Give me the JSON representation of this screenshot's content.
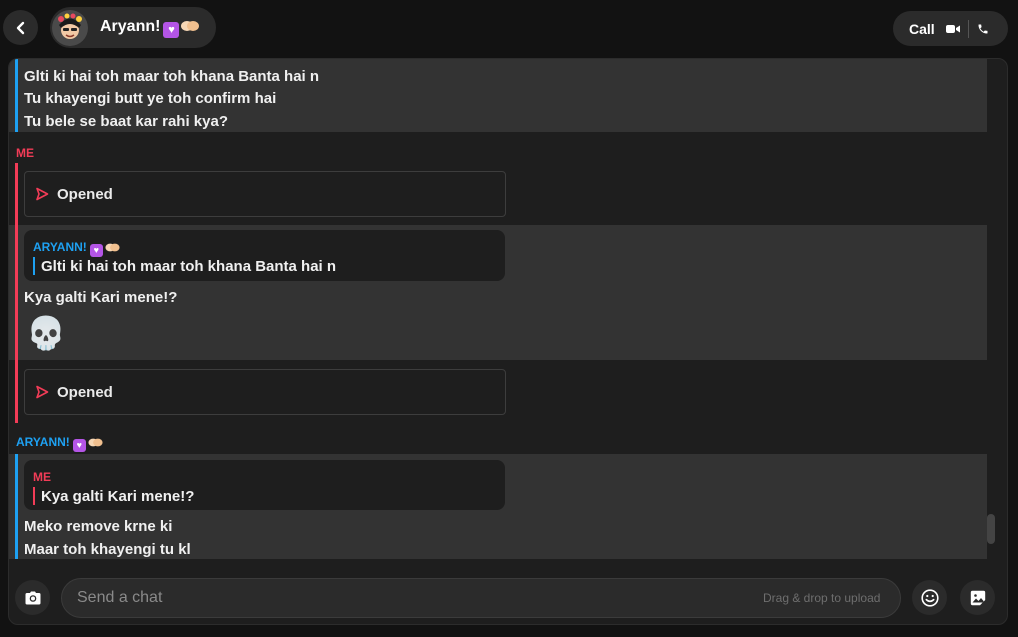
{
  "header": {
    "name": "Aryann!",
    "name_emoji_heart": "💟",
    "name_emoji_hands": "🫱🏻‍🫲🏼",
    "call_label": "Call",
    "icons": [
      "back-chevron-icon",
      "avatar",
      "video-camera-icon",
      "phone-icon"
    ]
  },
  "messages": [
    {
      "group": "continued",
      "sender": "",
      "lines": [
        "Glti ki hai toh maar toh khana Banta hai n",
        "Tu khayengi butt ye toh confirm hai",
        "Tu bele se baat kar rahi kya?"
      ]
    },
    {
      "group": "me",
      "sender": "ME",
      "opened_1": "Opened",
      "quote_sender": "ARYANN!",
      "quote_text": "Glti ki hai toh maar toh khana Banta hai n",
      "text": "Kya galti Kari mene!?",
      "emoji": "💀",
      "opened_2": "Opened"
    },
    {
      "group": "other",
      "sender": "ARYANN!",
      "quote_sender": "ME",
      "quote_text": "Kya galti Kari mene!?",
      "lines": [
        "Meko remove krne ki",
        "Maar toh khayengi tu kl"
      ]
    }
  ],
  "composer": {
    "placeholder": "Send a chat",
    "drag_hint": "Drag & drop to upload",
    "icons": [
      "camera-icon",
      "emoji-smile-icon",
      "sticker-icon"
    ]
  },
  "colors": {
    "me_accent": "#f23c57",
    "other_accent": "#1ea1f2",
    "background": "#121212",
    "panel": "#1e1e1e",
    "highlight": "#333333"
  }
}
